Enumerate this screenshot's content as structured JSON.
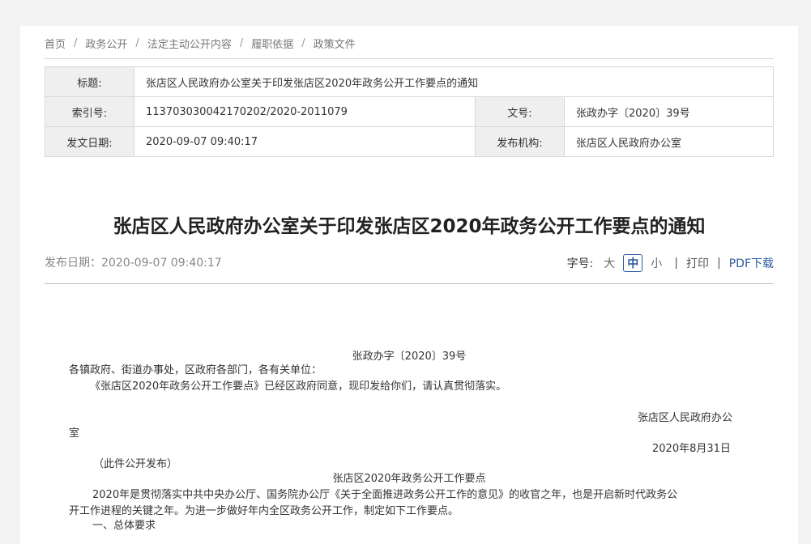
{
  "breadcrumb": [
    "首页",
    "政务公开",
    "法定主动公开内容",
    "履职依据",
    "政策文件"
  ],
  "meta": {
    "title_label": "标题:",
    "title_value": "张店区人民政府办公室关于印发张店区2020年政务公开工作要点的通知",
    "index_label": "索引号:",
    "index_value": "113703030042170202/2020-2011079",
    "docno_label": "文号:",
    "docno_value": "张政办字〔2020〕39号",
    "date_label": "发文日期:",
    "date_value": "2020-09-07 09:40:17",
    "org_label": "发布机构:",
    "org_value": "张店区人民政府办公室"
  },
  "article": {
    "title": "张店区人民政府办公室关于印发张店区2020年政务公开工作要点的通知",
    "pub_date": "发布日期：2020-09-07 09:40:17"
  },
  "tools": {
    "font_label": "字号:",
    "large": "大",
    "medium": "中",
    "small": "小",
    "sep": "|",
    "print": "打印",
    "pdf": "PDF下载"
  },
  "body": {
    "doc_no": "张政办字〔2020〕39号",
    "recipients": "各镇政府、街道办事处，区政府各部门，各有关单位：",
    "intro": "《张店区2020年政务公开工作要点》已经区政府同意，现印发给你们，请认真贯彻落实。",
    "sign_line1": "张店区人民政府办公",
    "sign_line2": "室",
    "date": "2020年8月31日",
    "public_note": "（此件公开发布）",
    "subtitle": "张店区2020年政务公开工作要点",
    "para1_line1": "2020年是贯彻落实中共中央办公厅、国务院办公厅《关于全面推进政务公开工作的意见》的收官之年，也是开启新时代政务公",
    "para1_line2": "开工作进程的关键之年。为进一步做好年内全区政务公开工作，制定如下工作要点。",
    "section1": "一、总体要求"
  }
}
